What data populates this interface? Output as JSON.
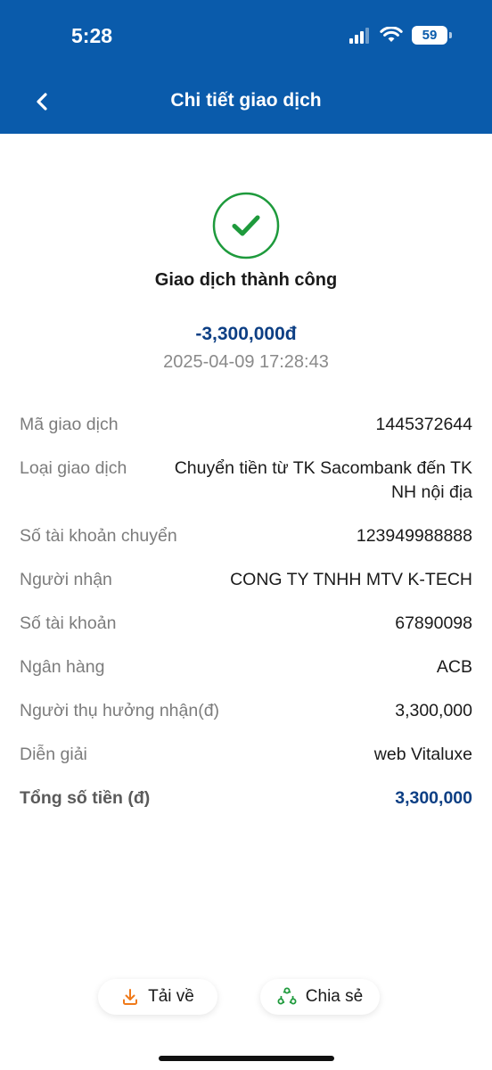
{
  "status_bar": {
    "time": "5:28",
    "battery": "59"
  },
  "header": {
    "title": "Chi tiết giao dịch",
    "background_color": "#0a5bab"
  },
  "result": {
    "status_icon": "check-circle-icon",
    "status_text": "Giao dịch thành công",
    "amount": "-3,300,000đ",
    "datetime": "2025-04-09 17:28:43",
    "success_color": "#1e9a3c",
    "amount_color": "#0d3f84"
  },
  "details": {
    "transaction_id": {
      "label": "Mã giao dịch",
      "value": "1445372644"
    },
    "transaction_type": {
      "label": "Loại giao dịch",
      "value": "Chuyển tiền từ TK Sacombank đến TK NH nội địa"
    },
    "source_account": {
      "label": "Số tài khoản chuyển",
      "value": "123949988888"
    },
    "recipient": {
      "label": "Người nhận",
      "value": "CONG TY TNHH MTV K-TECH"
    },
    "account_number": {
      "label": "Số tài khoản",
      "value": "67890098"
    },
    "bank": {
      "label": "Ngân hàng",
      "value": "ACB"
    },
    "beneficiary_received": {
      "label": "Người thụ hưởng nhận(đ)",
      "value": "3,300,000"
    },
    "description": {
      "label": "Diễn giải",
      "value": "web Vitaluxe"
    },
    "total": {
      "label": "Tổng số tiền (đ)",
      "value": "3,300,000"
    }
  },
  "actions": {
    "download": {
      "label": "Tải về",
      "icon": "download-icon",
      "color": "#f07a1a"
    },
    "share": {
      "label": "Chia sẻ",
      "icon": "share-icon",
      "color": "#1e9a3c"
    }
  }
}
